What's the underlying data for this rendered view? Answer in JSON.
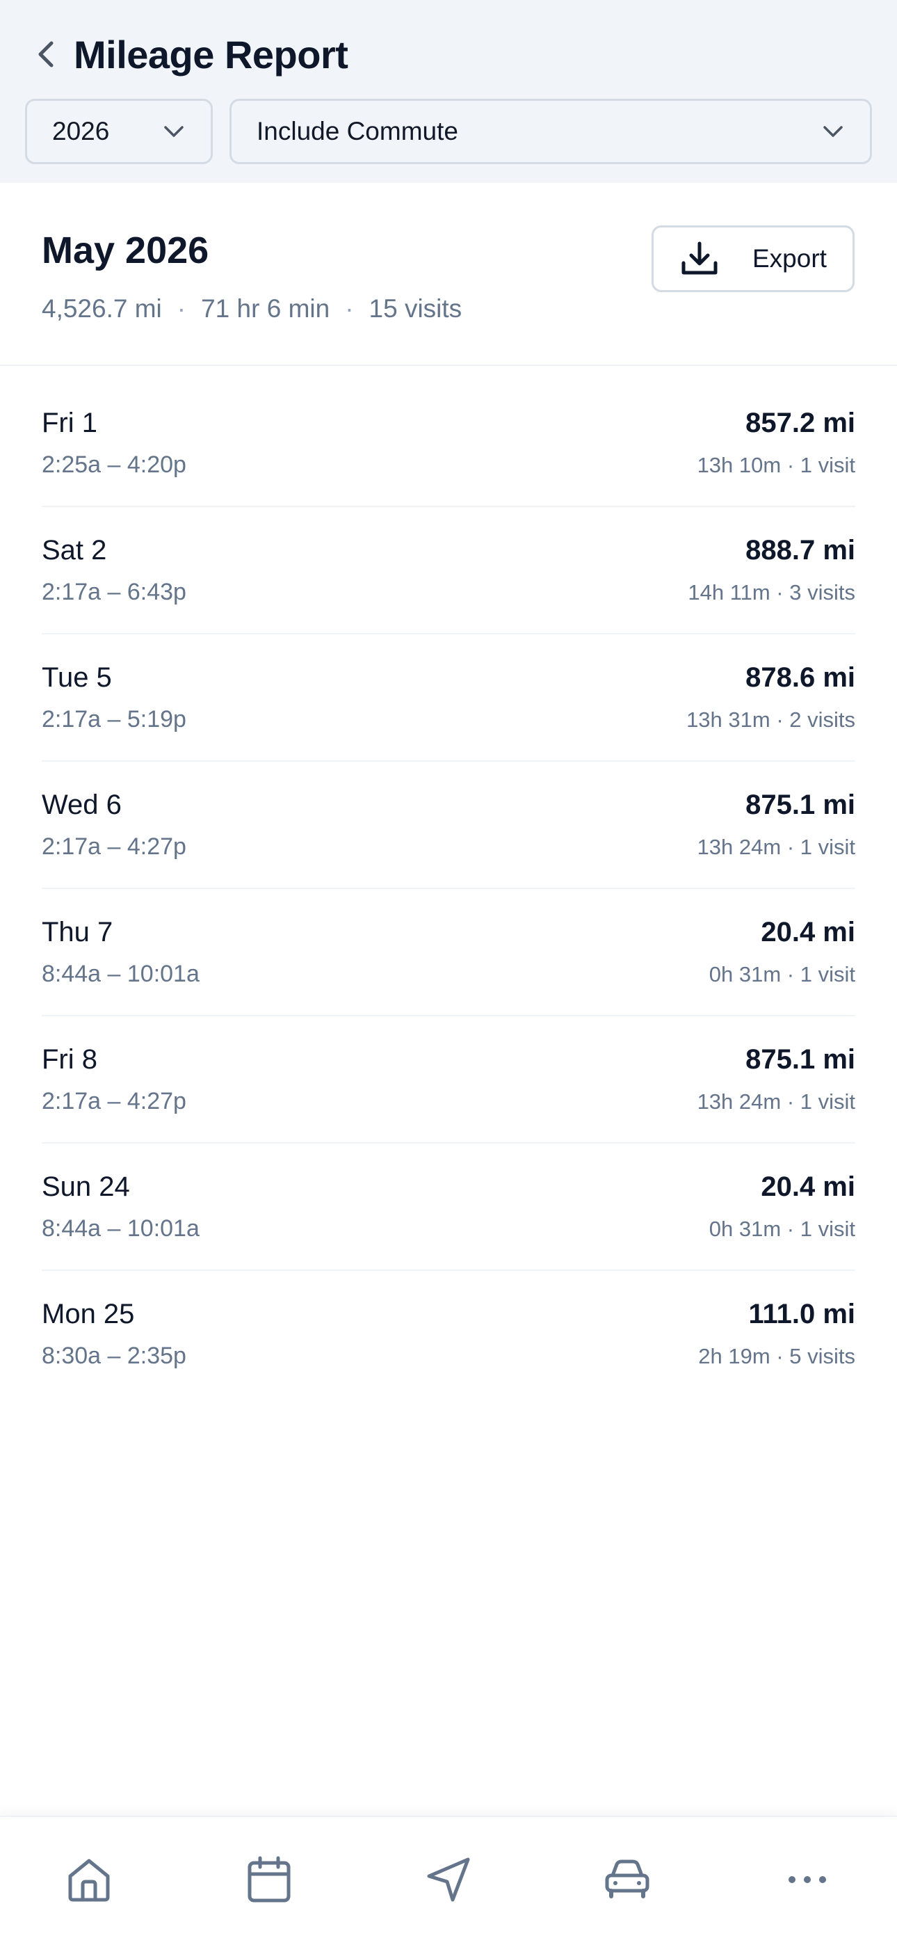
{
  "header": {
    "title": "Mileage Report",
    "year_select": {
      "value": "2026"
    },
    "commute_select": {
      "value": "Include Commute"
    }
  },
  "summary": {
    "month": "May 2026",
    "distance": "4,526.7 mi",
    "duration": "71 hr 6 min",
    "visits": "15 visits",
    "separator": "·",
    "export_label": "Export"
  },
  "days": [
    {
      "day": "Fri 1",
      "time": "2:25a – 4:20p",
      "miles": "857.2 mi",
      "meta": "13h 10m · 1 visit"
    },
    {
      "day": "Sat 2",
      "time": "2:17a – 6:43p",
      "miles": "888.7 mi",
      "meta": "14h 11m · 3 visits"
    },
    {
      "day": "Tue 5",
      "time": "2:17a – 5:19p",
      "miles": "878.6 mi",
      "meta": "13h 31m · 2 visits"
    },
    {
      "day": "Wed 6",
      "time": "2:17a – 4:27p",
      "miles": "875.1 mi",
      "meta": "13h 24m · 1 visit"
    },
    {
      "day": "Thu 7",
      "time": "8:44a – 10:01a",
      "miles": "20.4 mi",
      "meta": "0h 31m · 1 visit"
    },
    {
      "day": "Fri 8",
      "time": "2:17a – 4:27p",
      "miles": "875.1 mi",
      "meta": "13h 24m · 1 visit"
    },
    {
      "day": "Sun 24",
      "time": "8:44a – 10:01a",
      "miles": "20.4 mi",
      "meta": "0h 31m · 1 visit"
    },
    {
      "day": "Mon 25",
      "time": "8:30a – 2:35p",
      "miles": "111.0 mi",
      "meta": "2h 19m · 5 visits"
    }
  ],
  "nav": [
    {
      "icon": "home-icon"
    },
    {
      "icon": "calendar-icon"
    },
    {
      "icon": "navigation-icon"
    },
    {
      "icon": "car-icon"
    },
    {
      "icon": "more-icon"
    }
  ],
  "colors": {
    "header_bg": "#f1f4f8",
    "text_primary": "#0f172a",
    "text_secondary": "#64748b",
    "border": "#d4dbe5",
    "icon": "#64748b"
  }
}
